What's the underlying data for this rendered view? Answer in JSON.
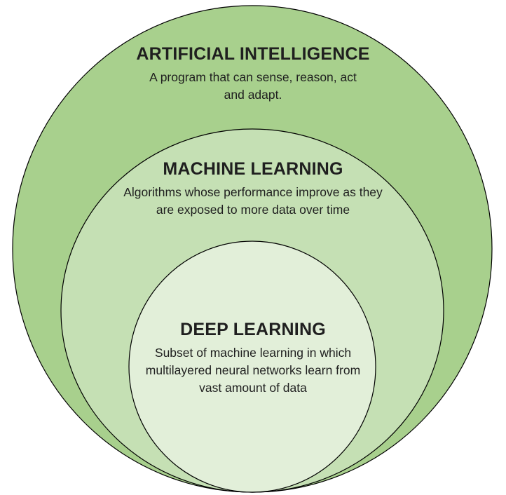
{
  "colors": {
    "outer_fill": "#a8d08d",
    "middle_fill": "#c5e0b4",
    "inner_fill": "#e2efd9",
    "stroke": "#000000",
    "text": "#1f1f1f"
  },
  "circles": [
    {
      "heading": "ARTIFICIAL INTELLIGENCE",
      "description_lines": [
        "A program that can sense, reason, act",
        "and adapt."
      ]
    },
    {
      "heading": "MACHINE LEARNING",
      "description_lines": [
        "Algorithms whose performance improve as they",
        "are exposed to more data over time"
      ]
    },
    {
      "heading": "DEEP LEARNING",
      "description_lines": [
        "Subset of machine learning in which",
        "multilayered neural networks learn from",
        "vast amount of data"
      ]
    }
  ]
}
